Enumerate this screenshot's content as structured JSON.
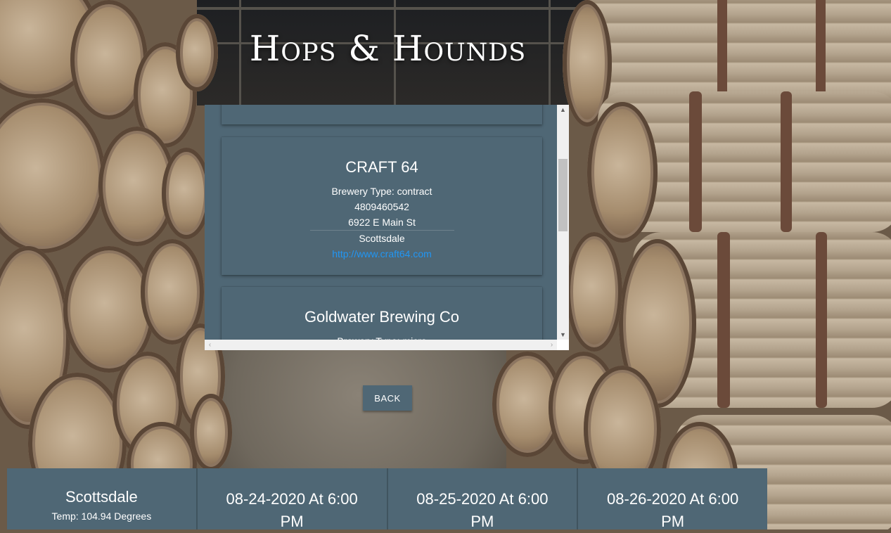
{
  "header": {
    "title": "Hops & Hounds"
  },
  "breweries": [
    {
      "name": "CRAFT 64",
      "type": "Brewery Type: contract",
      "phone": "4809460542",
      "street": "6922 E Main St",
      "city": "Scottsdale",
      "website": "http://www.craft64.com"
    },
    {
      "name": "Goldwater Brewing Co",
      "type": "Brewery Type: micro"
    }
  ],
  "back_label": "BACK",
  "weather": {
    "city": "Scottsdale",
    "temp": "Temp: 104.94 Degrees",
    "forecast": [
      {
        "date": "08-24-2020 At 6:00 PM"
      },
      {
        "date": "08-25-2020 At 6:00 PM"
      },
      {
        "date": "08-26-2020 At 6:00 PM"
      }
    ]
  },
  "colors": {
    "card": "#4f6775",
    "link": "#2196f3"
  }
}
